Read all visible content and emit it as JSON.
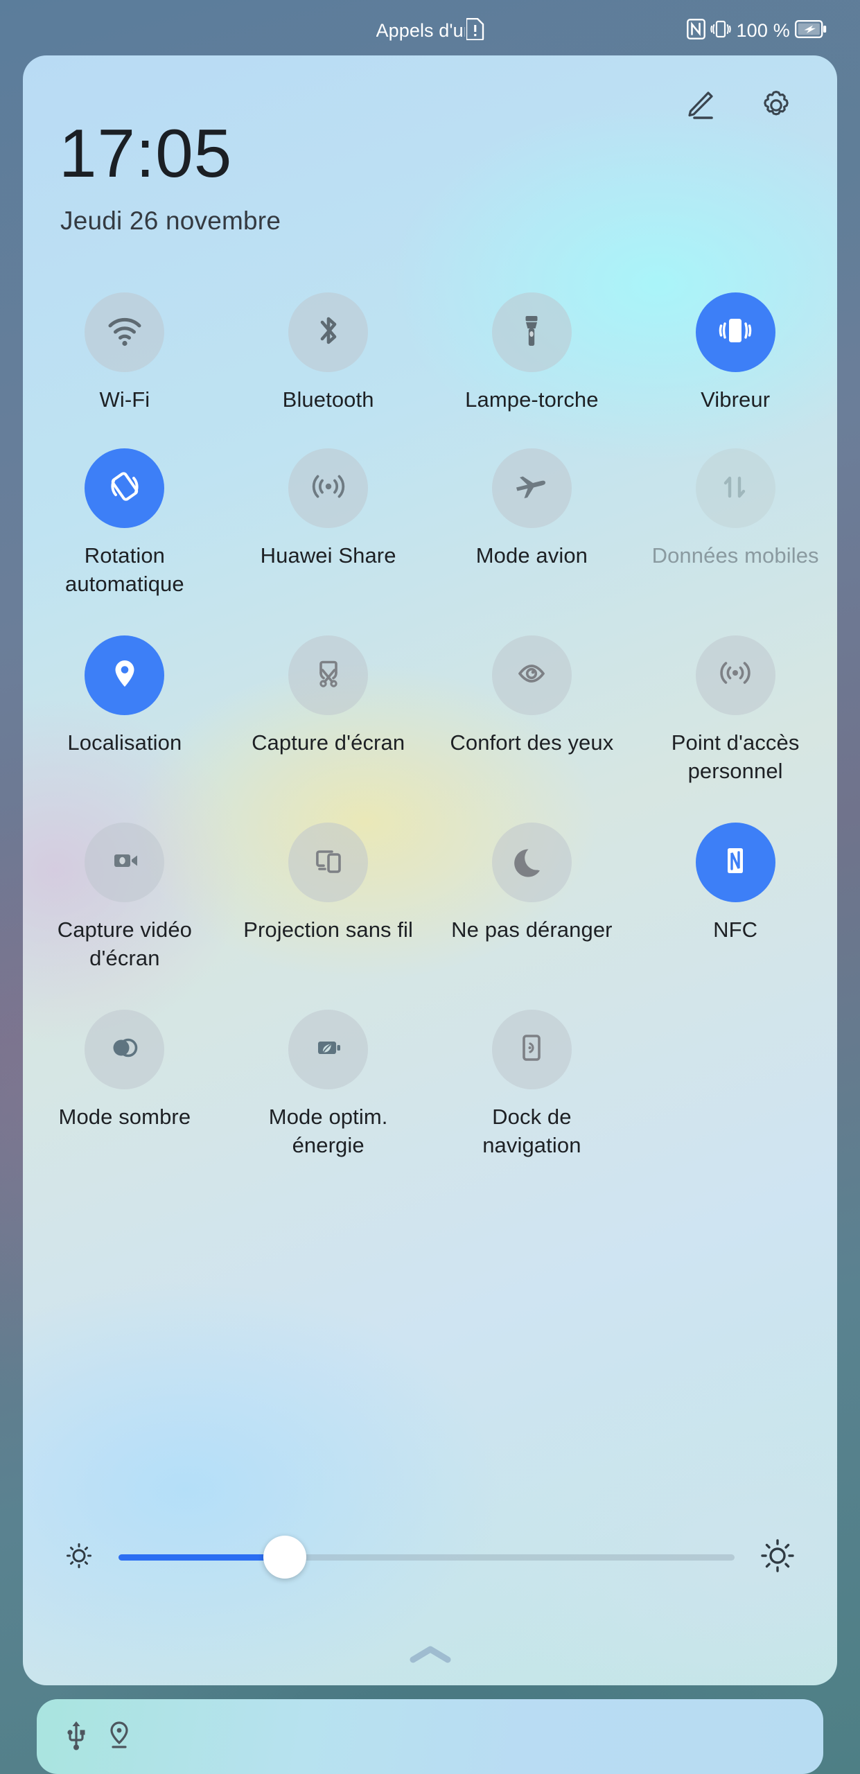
{
  "statusbar": {
    "emergency_text": "Appels d'urg",
    "sim_icon": "sim-alert-icon",
    "nfc_icon": "nfc-icon",
    "vibrate_icon": "vibrate-icon",
    "battery_percent": "100 %",
    "battery_icon": "battery-charging-icon"
  },
  "header": {
    "clock": "17:05",
    "date": "Jeudi 26 novembre",
    "edit_icon": "pencil-edit-icon",
    "settings_icon": "gear-icon"
  },
  "tiles": [
    {
      "label": "Wi-Fi",
      "icon": "wifi-icon",
      "state": "off"
    },
    {
      "label": "Bluetooth",
      "icon": "bluetooth-icon",
      "state": "off"
    },
    {
      "label": "Lampe-torche",
      "icon": "flashlight-icon",
      "state": "off"
    },
    {
      "label": "Vibreur",
      "icon": "vibrate-icon",
      "state": "on"
    },
    {
      "label": "Rotation automatique",
      "icon": "screen-rotation-icon",
      "state": "on"
    },
    {
      "label": "Huawei Share",
      "icon": "huawei-share-icon",
      "state": "off"
    },
    {
      "label": "Mode avion",
      "icon": "airplane-icon",
      "state": "off"
    },
    {
      "label": "Données mobiles",
      "icon": "mobile-data-icon",
      "state": "disabled"
    },
    {
      "label": "Localisation",
      "icon": "location-pin-icon",
      "state": "on"
    },
    {
      "label": "Capture d'écran",
      "icon": "screenshot-icon",
      "state": "off"
    },
    {
      "label": "Confort des yeux",
      "icon": "eye-comfort-icon",
      "state": "off"
    },
    {
      "label": "Point d'accès personnel",
      "icon": "hotspot-icon",
      "state": "off"
    },
    {
      "label": "Capture vidéo d'écran",
      "icon": "screen-record-icon",
      "state": "off"
    },
    {
      "label": "Projection sans fil",
      "icon": "wireless-cast-icon",
      "state": "off"
    },
    {
      "label": "Ne pas déranger",
      "icon": "moon-icon",
      "state": "off"
    },
    {
      "label": "NFC",
      "icon": "nfc-icon",
      "state": "on"
    },
    {
      "label": "Mode sombre",
      "icon": "dark-mode-icon",
      "state": "off"
    },
    {
      "label": "Mode optim. énergie",
      "icon": "battery-saver-icon",
      "state": "off"
    },
    {
      "label": "Dock de navigation",
      "icon": "nav-dock-icon",
      "state": "off"
    }
  ],
  "brightness": {
    "low_icon": "brightness-low-icon",
    "high_icon": "brightness-high-icon",
    "value_percent": 27
  },
  "collapse": {
    "icon": "chevron-up-icon"
  },
  "notification_card": {
    "usb_icon": "usb-icon",
    "location_icon": "location-pin-icon"
  },
  "colors": {
    "accent_on": "#3d7ff7",
    "slider_fill": "#2b6ef2",
    "label_text": "#1d2024",
    "label_disabled": "#8a9aa0"
  }
}
